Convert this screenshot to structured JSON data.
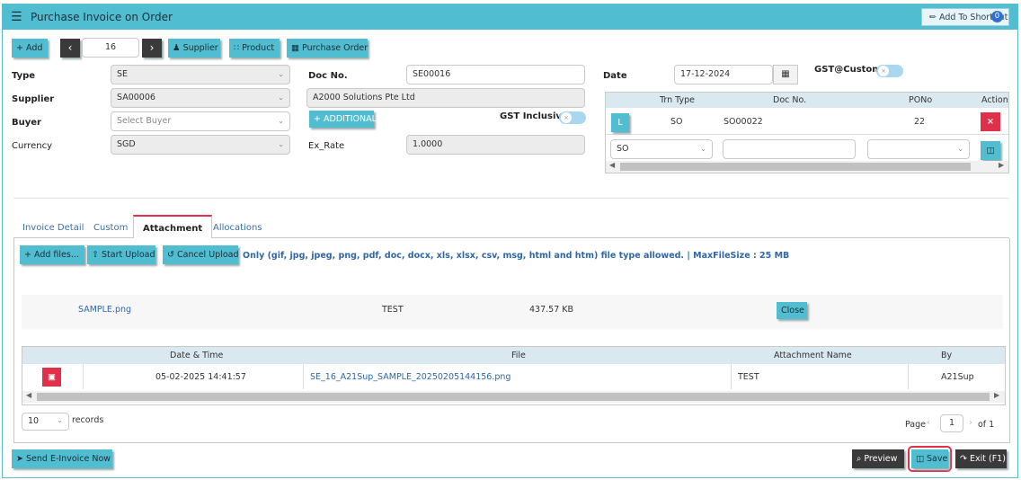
{
  "window": {
    "title": "Purchase Invoice on Order",
    "shortcut_label": "Add To ShortCut",
    "shortcut_count": "0",
    "menu_icon": "hamburger-icon"
  },
  "toolbar": {
    "add_label": "Add",
    "record_number": "16",
    "supplier_label": "Supplier",
    "product_label": "Product",
    "purchase_order_label": "Purchase Order"
  },
  "form": {
    "type_label": "Type",
    "type_value": "SE",
    "supplier_label": "Supplier",
    "supplier_value": "SA00006",
    "buyer_label": "Buyer",
    "buyer_placeholder": "Select Buyer",
    "currency_label": "Currency",
    "currency_value": "SGD",
    "docno_label": "Doc No.",
    "docno_value": "SE00016",
    "supplier_name": "A2000 Solutions Pte Ltd",
    "additional_label": "ADDITIONAL",
    "gst_inclusive_label": "GST Inclusive",
    "exrate_label": "Ex_Rate",
    "exrate_value": "1.0000",
    "date_label": "Date",
    "date_value": "17-12-2024",
    "gst_custom_label": "GST@Custom"
  },
  "order_grid": {
    "headers": [
      "Trn Type",
      "Doc No.",
      "PONo",
      "Action"
    ],
    "row": {
      "link_label": "L",
      "trn_type": "SO",
      "doc_no": "SO00022",
      "po_no": "22"
    },
    "new_row": {
      "trn_type": "SO"
    }
  },
  "tabs": [
    "Invoice Detail",
    "Custom",
    "Attachment",
    "Allocations"
  ],
  "attachment": {
    "add_files_label": "Add files...",
    "start_upload_label": "Start Upload",
    "cancel_upload_label": "Cancel Upload",
    "allowed_note": "Only (gif, jpg, jpeg, png, pdf, doc, docx, xls, xlsx, csv, msg, html and htm) file type allowed. | MaxFileSize : 25 MB",
    "pending_file": {
      "name": "SAMPLE.png",
      "attachment_name": "TEST",
      "size": "437.57 KB",
      "close_label": "Close"
    },
    "table": {
      "headers": [
        "Date & Time",
        "File",
        "Attachment Name",
        "By"
      ],
      "rows": [
        {
          "datetime": "05-02-2025 14:41:57",
          "file": "SE_16_A21Sup_SAMPLE_20250205144156.png",
          "attachment_name": "TEST",
          "by": "A21Sup"
        }
      ]
    },
    "page_size": "10",
    "records_label": "records",
    "page_label": "Page",
    "page_number": "1",
    "page_of": "of 1"
  },
  "footer": {
    "einvoice_label": "Send E-Invoice Now",
    "preview_label": "Preview",
    "save_label": "Save",
    "exit_label": "Exit (F1)"
  },
  "colors": {
    "accent": "#51bdd1",
    "danger": "#e0304a",
    "dark": "#3a3a3a"
  }
}
